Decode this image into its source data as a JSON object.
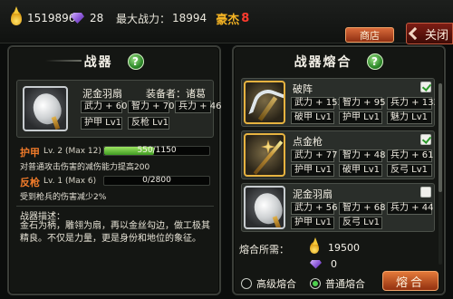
{
  "topbar": {
    "gold": "1519896",
    "gems": "28",
    "max_power_label": "最大战力：",
    "max_power_value": "18994",
    "hero_label": "豪杰",
    "hero_level": "8",
    "shop_label": "商店",
    "close_label": "关闭"
  },
  "left_panel": {
    "title": "战器",
    "help_label": "?",
    "weapon": {
      "icon": "feather-fan-icon",
      "name": "泥金羽扇",
      "equipper_label": "装备者：诸葛亮",
      "stats": [
        "武力 + 60",
        "智力 + 70",
        "兵力 + 46",
        "护甲 Lv1",
        "反枪 Lv1"
      ]
    },
    "skill1": {
      "name": "护甲",
      "level": "Lv. 2 (Max 12)",
      "progress_text": "550/1150",
      "progress": 0.478,
      "desc": "对普通攻击伤害的减伤能力提高200"
    },
    "skill2": {
      "name": "反枪",
      "level": "Lv. 1 (Max 6)",
      "progress_text": "0/2800",
      "progress": 0,
      "desc": "受到枪兵的伤害减少2%"
    },
    "description_title": "战器描述：",
    "description": "金石为柄，雕翎为扇，再以金丝勾边，做工极其精良。不仅是力量，更是身份和地位的象征。"
  },
  "right_panel": {
    "title": "战器熔合",
    "help_label": "?",
    "items": [
      {
        "icon": "halberd-icon",
        "name": "破阵",
        "checked": true,
        "stats": [
          "武力 + 153",
          "智力 + 95",
          "兵力 + 133",
          "破甲 Lv1",
          "护甲 Lv1",
          "魅力 Lv1"
        ]
      },
      {
        "icon": "gold-spear-icon",
        "name": "点金枪",
        "checked": true,
        "stats": [
          "武力 + 77",
          "智力 + 48",
          "兵力 + 61",
          "护甲 Lv1",
          "破甲 Lv1",
          "反弓 Lv1"
        ]
      },
      {
        "icon": "feather-fan-icon",
        "name": "泥金羽扇",
        "checked": false,
        "stats": [
          "武力 + 56",
          "智力 + 68",
          "兵力 + 44",
          "护甲 Lv1",
          "反弓 Lv1"
        ]
      }
    ],
    "cost_label": "熔合所需：",
    "cost_gold": "19500",
    "cost_gems": "0",
    "option_high": "高级熔合",
    "option_normal": "普通熔合",
    "selected_option": "普通熔合",
    "fuse_label": "熔合"
  },
  "colors": {
    "accent_orange": "#f07b2a",
    "hero_gold": "#f4b323",
    "hero_red": "#ff3b2e",
    "progress_green": "#6cc63e"
  }
}
